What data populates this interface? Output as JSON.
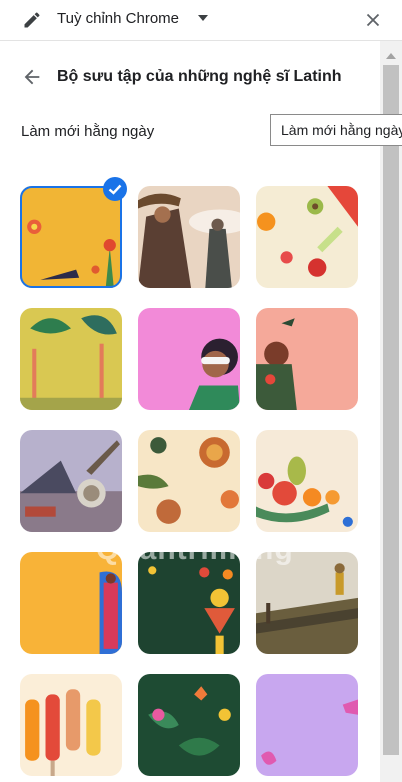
{
  "header": {
    "title": "Tuỳ chỉnh Chrome",
    "edit_icon": "pencil-icon",
    "dropdown_icon": "caret-down-icon",
    "close_icon": "close-icon"
  },
  "collection": {
    "back_icon": "arrow-back-icon",
    "title": "Bộ sưu tập của những nghệ sĩ Latinh",
    "daily_refresh_label": "Làm mới hằng ngày",
    "daily_refresh_on": false,
    "tooltip": "Làm mới hằng ngày"
  },
  "colors": {
    "accent": "#1a73e8",
    "toggle_track": "#bdc1c6"
  },
  "watermark": "Quantrimang",
  "selected_index": 0
}
